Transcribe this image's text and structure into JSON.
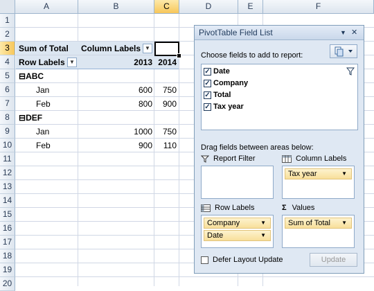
{
  "columns": [
    "A",
    "B",
    "C",
    "D",
    "E",
    "F"
  ],
  "rows": [
    "1",
    "2",
    "3",
    "4",
    "5",
    "6",
    "7",
    "8",
    "9",
    "10",
    "11",
    "12",
    "13",
    "14",
    "15",
    "16",
    "17",
    "18",
    "19",
    "20"
  ],
  "pivot": {
    "sum_label": "Sum of Total",
    "column_labels": "Column Labels",
    "row_labels": "Row Labels",
    "years": [
      "2013",
      "2014"
    ],
    "groups": [
      {
        "name": "ABC",
        "toggle": "⊟",
        "rows": [
          {
            "label": "Jan",
            "v2013": "600",
            "v2014": "750"
          },
          {
            "label": "Feb",
            "v2013": "800",
            "v2014": "900"
          }
        ]
      },
      {
        "name": "DEF",
        "toggle": "⊟",
        "rows": [
          {
            "label": "Jan",
            "v2013": "1000",
            "v2014": "750"
          },
          {
            "label": "Feb",
            "v2013": "900",
            "v2014": "110"
          }
        ]
      }
    ]
  },
  "field_list": {
    "title": "PivotTable Field List",
    "dropdown_glyph": "▼",
    "close_glyph": "✕",
    "choose_label": "Choose fields to add to report:",
    "fields": [
      {
        "label": "Date",
        "checked": "✓"
      },
      {
        "label": "Company",
        "checked": "✓"
      },
      {
        "label": "Total",
        "checked": "✓"
      },
      {
        "label": "Tax year",
        "checked": "✓"
      }
    ],
    "drag_label": "Drag fields between areas below:",
    "areas": {
      "report_filter": "Report Filter",
      "column_labels": "Column Labels",
      "row_labels": "Row Labels",
      "values": "Values"
    },
    "column_items": [
      "Tax year"
    ],
    "row_items": [
      "Company",
      "Date"
    ],
    "value_items": [
      "Sum of Total"
    ],
    "defer_label": "Defer Layout Update",
    "update_label": "Update"
  },
  "colors": {
    "accent_selected": "#f7c65a",
    "pivot_band": "#dce6f1",
    "pill": "#f8df9a"
  }
}
